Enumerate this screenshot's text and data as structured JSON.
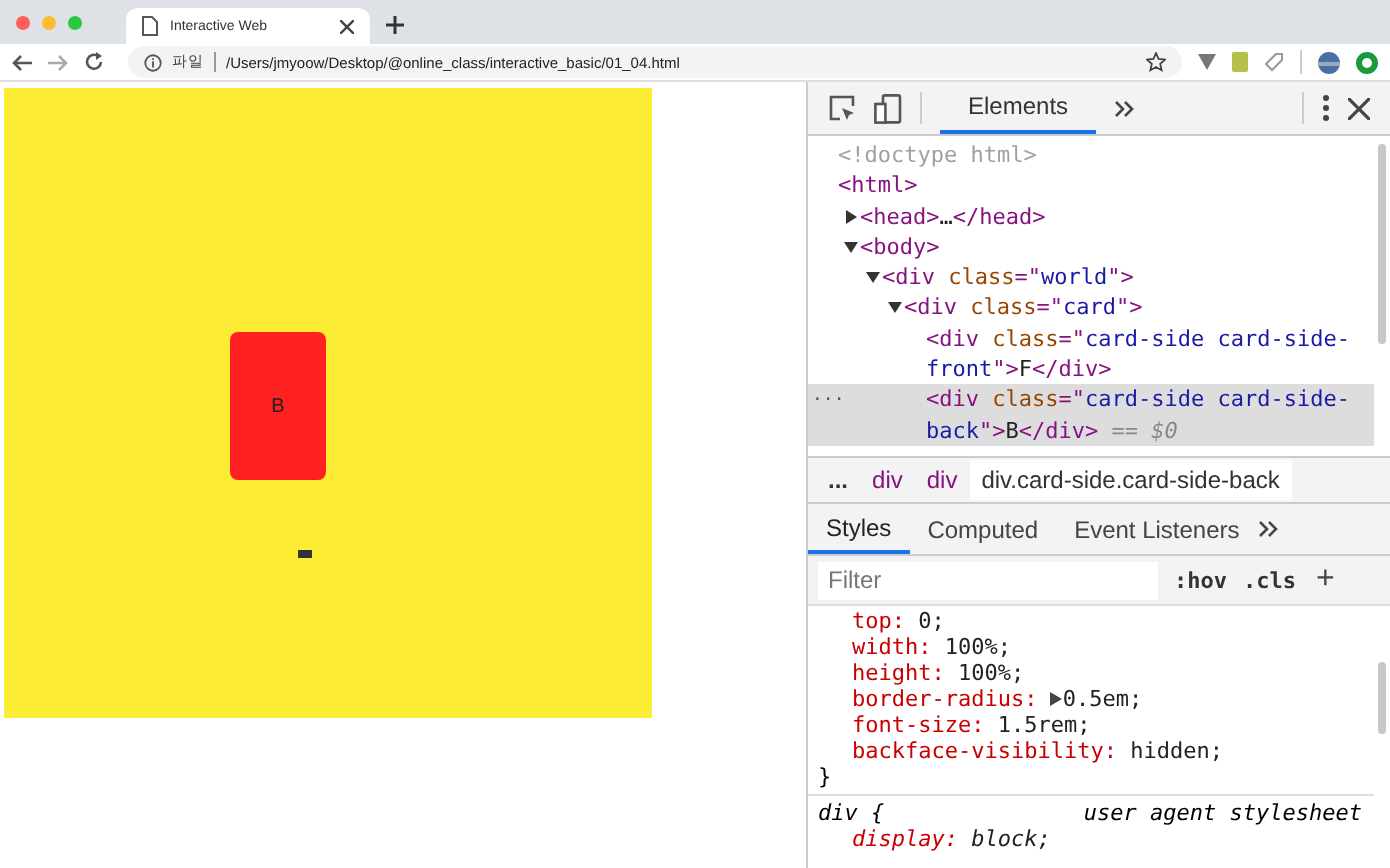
{
  "browser": {
    "tab": {
      "title": "Interactive Web",
      "selected": true
    },
    "address": {
      "scheme_label": "파일",
      "url": "/Users/jmyoow/Desktop/@online_class/interactive_basic/01_04.html"
    }
  },
  "page": {
    "card": {
      "label": "B"
    }
  },
  "devtools": {
    "tabs": [
      {
        "label": "Elements",
        "selected": true
      }
    ],
    "dom_tree": [
      {
        "parts": [
          {
            "kind": "doctype",
            "text": "<!doctype html>"
          }
        ],
        "selected": false
      },
      {
        "parts": [
          {
            "kind": "tag",
            "text": "<html>"
          }
        ],
        "selected": false,
        "children": [
          {
            "parts": [
              {
                "kind": "tag",
                "text": "<head>"
              },
              {
                "kind": "text",
                "text": "…"
              },
              {
                "kind": "tag",
                "text": "</head>"
              }
            ],
            "expanded": false,
            "selected": false
          },
          {
            "parts": [
              {
                "kind": "tag",
                "text": "<body>"
              }
            ],
            "expanded": true,
            "selected": false,
            "children": [
              {
                "parts": [
                  {
                    "kind": "tag",
                    "text": "<div "
                  },
                  {
                    "kind": "attr",
                    "text": "class"
                  },
                  {
                    "kind": "tag",
                    "text": "=\""
                  },
                  {
                    "kind": "value",
                    "text": "world"
                  },
                  {
                    "kind": "tag",
                    "text": "\">"
                  }
                ],
                "expanded": true,
                "selected": false,
                "children": [
                  {
                    "parts": [
                      {
                        "kind": "tag",
                        "text": "<div "
                      },
                      {
                        "kind": "attr",
                        "text": "class"
                      },
                      {
                        "kind": "tag",
                        "text": "=\""
                      },
                      {
                        "kind": "value",
                        "text": "card"
                      },
                      {
                        "kind": "tag",
                        "text": "\">"
                      }
                    ],
                    "expanded": true,
                    "selected": false,
                    "children": [
                      {
                        "parts": [
                          {
                            "kind": "tag",
                            "text": "<div "
                          },
                          {
                            "kind": "attr",
                            "text": "class"
                          },
                          {
                            "kind": "tag",
                            "text": "=\""
                          },
                          {
                            "kind": "value",
                            "text": "card-side card-side-front"
                          },
                          {
                            "kind": "tag",
                            "text": "\">"
                          },
                          {
                            "kind": "text",
                            "text": "F"
                          },
                          {
                            "kind": "tag",
                            "text": "</div>"
                          }
                        ],
                        "selected": false
                      },
                      {
                        "parts": [
                          {
                            "kind": "tag",
                            "text": "<div "
                          },
                          {
                            "kind": "attr",
                            "text": "class"
                          },
                          {
                            "kind": "tag",
                            "text": "=\""
                          },
                          {
                            "kind": "value",
                            "text": "card-side card-side-back"
                          },
                          {
                            "kind": "tag",
                            "text": "\">"
                          },
                          {
                            "kind": "text",
                            "text": "B"
                          },
                          {
                            "kind": "tag",
                            "text": "</div>"
                          },
                          {
                            "kind": "note",
                            "text": " == $0"
                          }
                        ],
                        "selected": true,
                        "gutter": "..."
                      }
                    ]
                  }
                ]
              }
            ]
          }
        ]
      }
    ],
    "breadcrumbs": [
      {
        "label": "...",
        "selected": false
      },
      {
        "label": "div",
        "selected": false
      },
      {
        "label": "div",
        "selected": false
      },
      {
        "label": "div.card-side.card-side-back",
        "selected": true
      }
    ],
    "styles_tabs": [
      {
        "label": "Styles",
        "selected": true
      },
      {
        "label": "Computed",
        "selected": false
      },
      {
        "label": "Event Listeners",
        "selected": false
      }
    ],
    "filter": {
      "placeholder": "Filter",
      "hov": ":hov",
      "cls": ".cls",
      "add": "+"
    },
    "declarations": [
      {
        "name": "top:",
        "value": "0;",
        "expandable": false
      },
      {
        "name": "width:",
        "value": "100%;",
        "expandable": false
      },
      {
        "name": "height:",
        "value": "100%;",
        "expandable": false
      },
      {
        "name": "border-radius:",
        "value": "0.5em;",
        "expandable": true
      },
      {
        "name": "font-size:",
        "value": "1.5rem;",
        "expandable": false
      },
      {
        "name": "backface-visibility:",
        "value": "hidden;",
        "expandable": false
      }
    ],
    "rule_close": "}",
    "ua_rule": {
      "selector": "div {",
      "source": "user agent stylesheet",
      "declaration": {
        "name": "display:",
        "value": "block;"
      }
    }
  }
}
